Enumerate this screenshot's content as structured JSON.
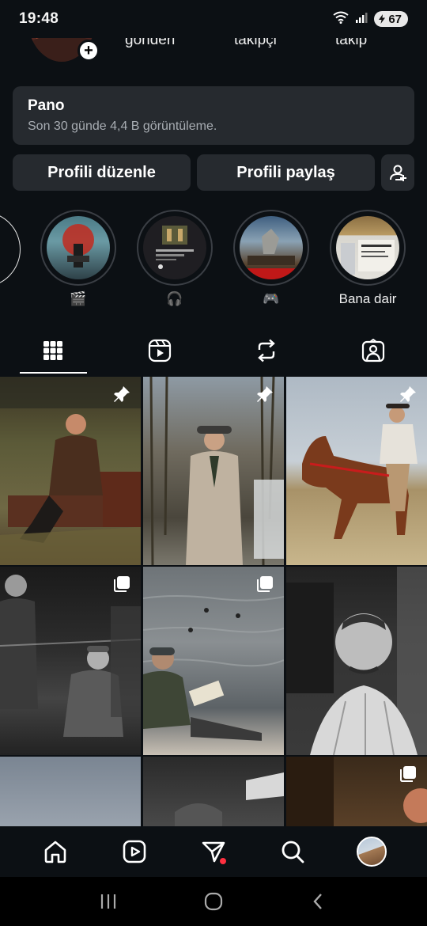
{
  "status_bar": {
    "time": "19:48",
    "battery": "67"
  },
  "profile": {
    "stats": {
      "posts_label": "gönderi",
      "followers_label": "takipçi",
      "following_label": "takip"
    }
  },
  "dashboard": {
    "title": "Pano",
    "subtitle": "Son 30 günde 4,4 B görüntüleme."
  },
  "actions": {
    "edit_profile": "Profili düzenle",
    "share_profile": "Profili paylaş"
  },
  "highlights": [
    {
      "label": "🎬",
      "icon": "clapper-board"
    },
    {
      "label": "🎧",
      "icon": "headphones"
    },
    {
      "label": "🎮",
      "icon": "game-controller"
    },
    {
      "label": "Bana dair",
      "icon": ""
    }
  ],
  "tabs": [
    {
      "name": "posts",
      "icon": "grid-icon",
      "active": true
    },
    {
      "name": "reels",
      "icon": "reels-icon",
      "active": false
    },
    {
      "name": "reposts",
      "icon": "repost-icon",
      "active": false
    },
    {
      "name": "tagged",
      "icon": "tagged-icon",
      "active": false
    }
  ],
  "grid": [
    {
      "badge": "pin"
    },
    {
      "badge": "pin"
    },
    {
      "badge": "pin"
    },
    {
      "badge": "carousel"
    },
    {
      "badge": "carousel"
    },
    {
      "badge": ""
    },
    {
      "badge": ""
    },
    {
      "badge": ""
    },
    {
      "badge": "carousel"
    }
  ],
  "bottom_nav": {
    "items": [
      "home",
      "reels",
      "messages",
      "search",
      "profile"
    ]
  },
  "colors": {
    "background": "#0c1014",
    "card": "#262a2f",
    "notification": "#ff3040"
  }
}
